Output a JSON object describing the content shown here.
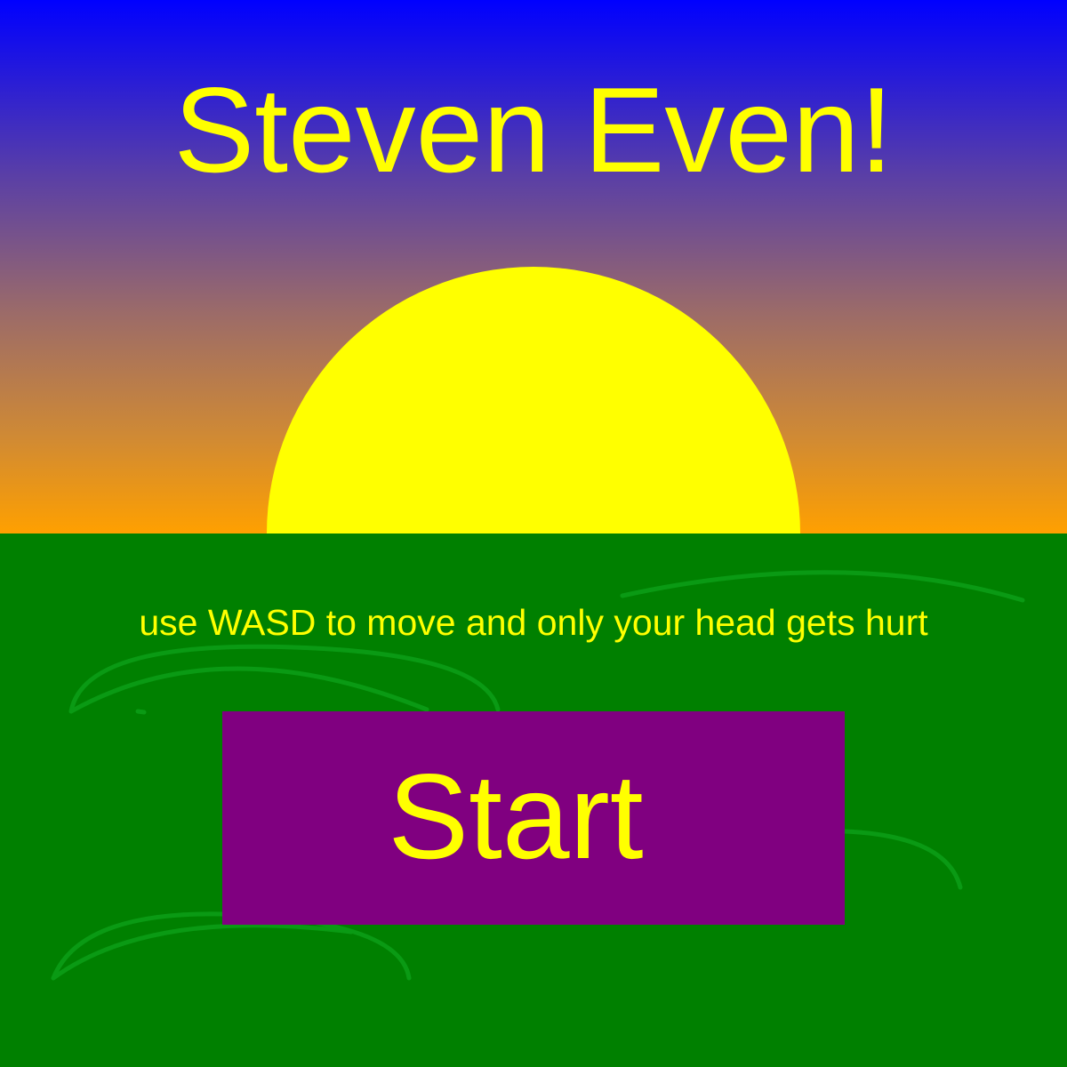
{
  "game": {
    "title": "Steven Even!",
    "instructions": "use WASD to move and only your head gets hurt",
    "start_label": "Start"
  },
  "colors": {
    "sky_top": "#0000ff",
    "sky_bottom": "#ffa000",
    "sun": "#ffff00",
    "ground": "#008000",
    "grass_arc": "#0a9a14",
    "text": "#ffff00",
    "start_button": "#800080"
  }
}
